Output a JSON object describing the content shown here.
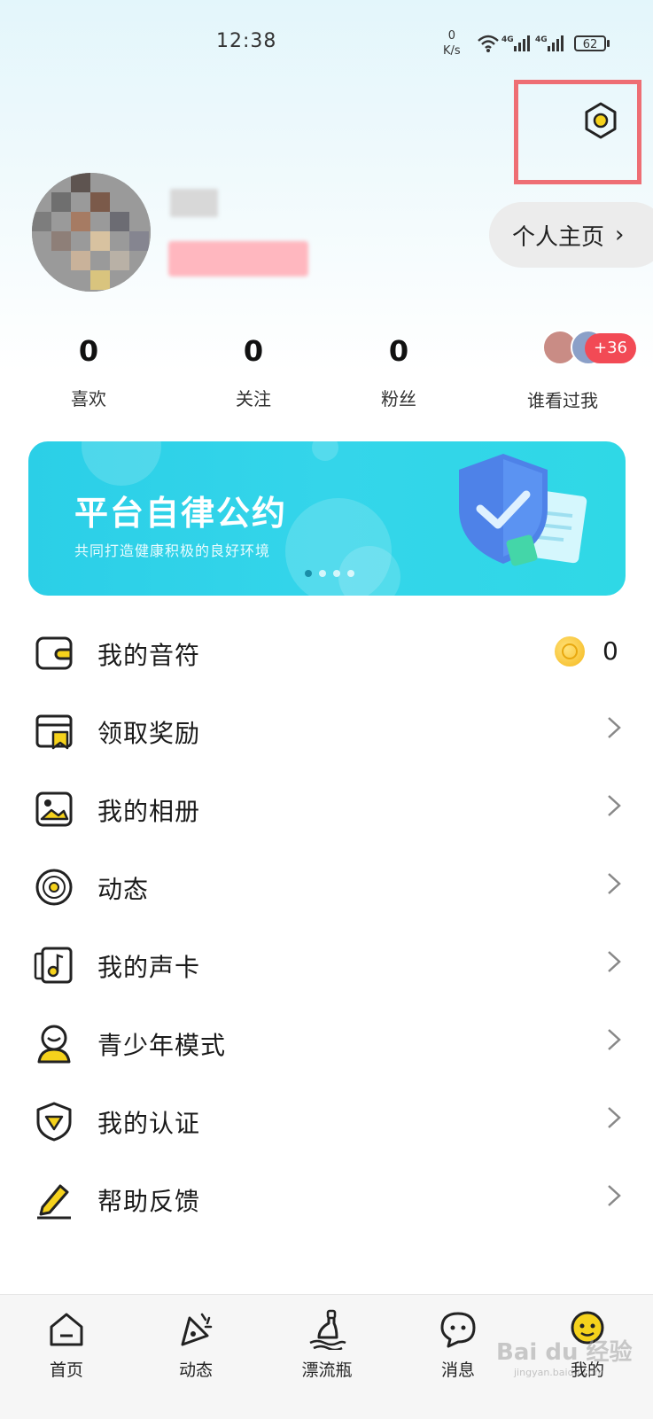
{
  "status_bar": {
    "time": "12:38",
    "net_speed_value": "0",
    "net_speed_unit": "K/s",
    "signal1_label": "4G",
    "signal2_label": "4G",
    "battery": "62"
  },
  "header": {
    "settings_icon": "gear-hexagon-icon",
    "homepage_button_label": "个人主页",
    "homepage_chevron": "›"
  },
  "stats": [
    {
      "value": "0",
      "label": "喜欢"
    },
    {
      "value": "0",
      "label": "关注"
    },
    {
      "value": "0",
      "label": "粉丝"
    }
  ],
  "visitors": {
    "badge": "+36",
    "label": "谁看过我"
  },
  "banner": {
    "title": "平台自律公约",
    "subtitle": "共同打造健康积极的良好环境",
    "dot_count": 4,
    "active_dot": 0
  },
  "menu": [
    {
      "label": "我的音符",
      "icon": "wallet-icon",
      "value": "0"
    },
    {
      "label": "领取奖励",
      "icon": "reward-bookmark-icon"
    },
    {
      "label": "我的相册",
      "icon": "photo-album-icon"
    },
    {
      "label": "动态",
      "icon": "vinyl-record-icon"
    },
    {
      "label": "我的声卡",
      "icon": "music-card-icon"
    },
    {
      "label": "青少年模式",
      "icon": "teen-mode-icon"
    },
    {
      "label": "我的认证",
      "icon": "shield-verify-icon"
    },
    {
      "label": "帮助反馈",
      "icon": "pencil-feedback-icon"
    }
  ],
  "bottom_nav": [
    {
      "label": "首页",
      "icon": "home-icon"
    },
    {
      "label": "动态",
      "icon": "party-popper-icon"
    },
    {
      "label": "漂流瓶",
      "icon": "drift-bottle-icon"
    },
    {
      "label": "消息",
      "icon": "chat-bubble-icon"
    },
    {
      "label": "我的",
      "icon": "smiley-face-icon"
    }
  ],
  "watermark": {
    "brand": "Bai du 经验",
    "url": "jingyan.baidu.com"
  },
  "colors": {
    "accent_yellow": "#f5d21c",
    "highlight_red": "#ee6e74",
    "badge_red": "#f24a55",
    "banner_cyan": "#2fd3e8"
  }
}
